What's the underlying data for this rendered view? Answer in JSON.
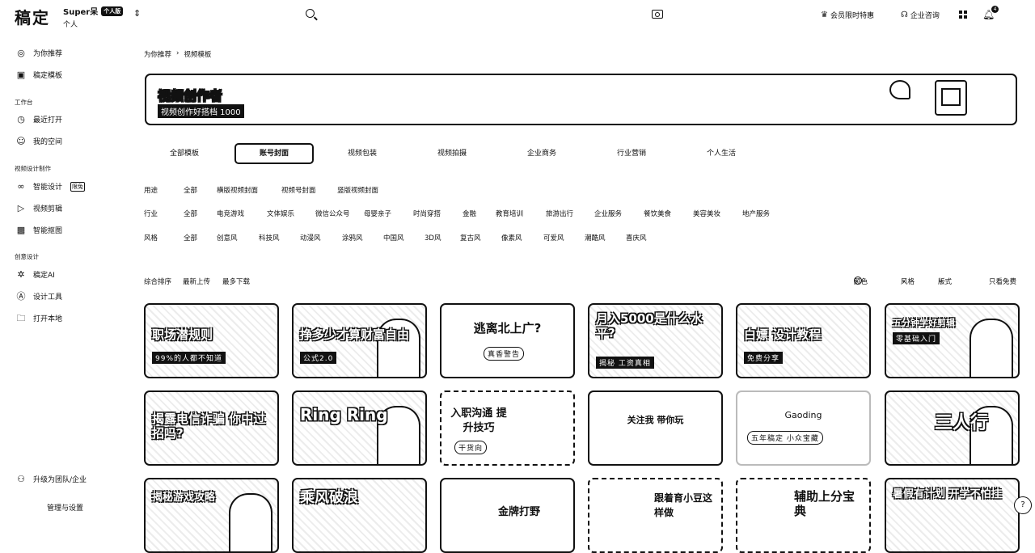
{
  "header": {
    "logo": "稿定",
    "account_name": "Super呆",
    "account_badge": "个人版",
    "account_type": "个人",
    "switch_icon": "chevron-up-down-icon",
    "vip_link": "会员限时特惠",
    "enterprise_link": "企业咨询",
    "notification_count": "4"
  },
  "sidebar": {
    "top_items": [
      {
        "label": "为你推荐",
        "icon": "compass-icon"
      },
      {
        "label": "稿定模板",
        "icon": "template-icon"
      }
    ],
    "workspace_title": "工作台",
    "workspace_items": [
      {
        "label": "最近打开",
        "icon": "clock-icon"
      },
      {
        "label": "我的空间",
        "icon": "user-icon"
      }
    ],
    "video_title": "视频设计制作",
    "video_items": [
      {
        "label": "智能设计",
        "icon": "infinity-icon",
        "tag": "限免"
      },
      {
        "label": "视频剪辑",
        "icon": "play-icon"
      },
      {
        "label": "智能抠图",
        "icon": "image-cutout-icon"
      }
    ],
    "creative_title": "创意设计",
    "creative_items": [
      {
        "label": "稿定AI",
        "icon": "ai-icon"
      },
      {
        "label": "设计工具",
        "icon": "design-tool-icon"
      },
      {
        "label": "打开本地",
        "icon": "folder-icon"
      }
    ],
    "upgrade_label": "升级为团队/企业",
    "manage_label": "管理与设置"
  },
  "breadcrumb": [
    "为你推荐",
    "视频模板"
  ],
  "banner": {
    "title": "视频创作者",
    "subtitle": "视频创作好搭档 1000"
  },
  "tabs": [
    {
      "label": "全部模板",
      "active": false
    },
    {
      "label": "账号封面",
      "active": true
    },
    {
      "label": "视频包装",
      "active": false
    },
    {
      "label": "视频拍摄",
      "active": false
    },
    {
      "label": "企业商务",
      "active": false
    },
    {
      "label": "行业营销",
      "active": false
    },
    {
      "label": "个人生活",
      "active": false
    }
  ],
  "filters": {
    "use": {
      "label": "用途",
      "options": [
        "全部",
        "横版视频封面",
        "视频号封面",
        "竖版视频封面"
      ]
    },
    "industry": {
      "label": "行业",
      "options": [
        "全部",
        "电竞游戏",
        "文体娱乐",
        "微信公众号",
        "母婴亲子",
        "时尚穿搭",
        "金融",
        "教育培训",
        "旅游出行",
        "企业服务",
        "餐饮美食",
        "美容美妆",
        "地产服务"
      ]
    },
    "style": {
      "label": "风格",
      "options": [
        "全部",
        "创意风",
        "科技风",
        "动漫风",
        "涂鸦风",
        "中国风",
        "3D风",
        "复古风",
        "像素风",
        "可爱风",
        "潮酷风",
        "喜庆风"
      ]
    }
  },
  "sort": {
    "options": [
      "综合排序",
      "最新上传",
      "最多下载"
    ],
    "right": {
      "color": "颜色",
      "style": "风格",
      "layout": "版式",
      "free_only": "只看免费"
    }
  },
  "cards": [
    {
      "title": "职场潜规则",
      "sub": "99%的人都不知道"
    },
    {
      "title": "挣多少才算财富自由",
      "sub": "公式2.0"
    },
    {
      "title": "逃离北上广?",
      "sub": "真香警告"
    },
    {
      "title": "月入5000是什么水平?",
      "sub": "揭秘 工资真相"
    },
    {
      "title": "白嫖 设计教程",
      "sub": "免费分享"
    },
    {
      "title": "五分钟学好剪辑",
      "sub": "零基础入门"
    },
    {
      "title": "揭露电信诈骗 你中过招吗?",
      "sub": ""
    },
    {
      "title": "Ring Ring",
      "sub": ""
    },
    {
      "title": "入职沟通 提升技巧",
      "sub": "干货向"
    },
    {
      "title": "关注我 带你玩",
      "sub": ""
    },
    {
      "title": "Gaoding",
      "sub": "五年稿定 小众宝藏"
    },
    {
      "title": "三人行",
      "sub": ""
    },
    {
      "title": "揭秘游戏攻略",
      "sub": ""
    },
    {
      "title": "乘风破浪",
      "sub": ""
    },
    {
      "title": "金牌打野",
      "sub": ""
    },
    {
      "title": "跟着育小豆这样做",
      "sub": ""
    },
    {
      "title": "辅助上分宝典",
      "sub": ""
    },
    {
      "title": "暑假有计划 开学不怕挂",
      "sub": ""
    }
  ]
}
